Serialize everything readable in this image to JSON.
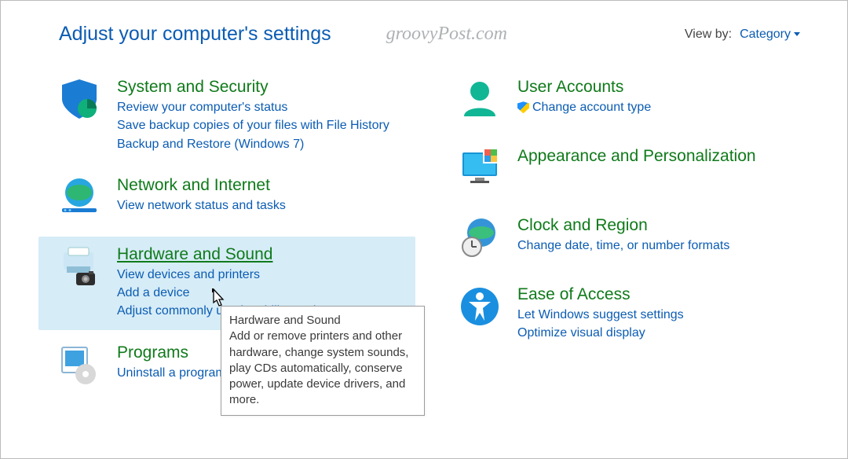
{
  "header": {
    "title": "Adjust your computer's settings",
    "watermark": "groovyPost.com",
    "viewby_label": "View by:",
    "viewby_value": "Category"
  },
  "left": [
    {
      "title": "System and Security",
      "links": [
        "Review your computer's status",
        "Save backup copies of your files with File History",
        "Backup and Restore (Windows 7)"
      ]
    },
    {
      "title": "Network and Internet",
      "links": [
        "View network status and tasks"
      ]
    },
    {
      "title": "Hardware and Sound",
      "hovered": true,
      "links": [
        "View devices and printers",
        "Add a device",
        "Adjust commonly used mobility settings"
      ]
    },
    {
      "title": "Programs",
      "links": [
        "Uninstall a program"
      ]
    }
  ],
  "right": [
    {
      "title": "User Accounts",
      "links": [
        {
          "shield": true,
          "text": "Change account type"
        }
      ]
    },
    {
      "title": "Appearance and Personalization",
      "links": []
    },
    {
      "title": "Clock and Region",
      "links": [
        "Change date, time, or number formats"
      ]
    },
    {
      "title": "Ease of Access",
      "links": [
        "Let Windows suggest settings",
        "Optimize visual display"
      ]
    }
  ],
  "tooltip": {
    "title": "Hardware and Sound",
    "body": "Add or remove printers and other hardware, change system sounds, play CDs automatically, conserve power, update device drivers, and more."
  }
}
